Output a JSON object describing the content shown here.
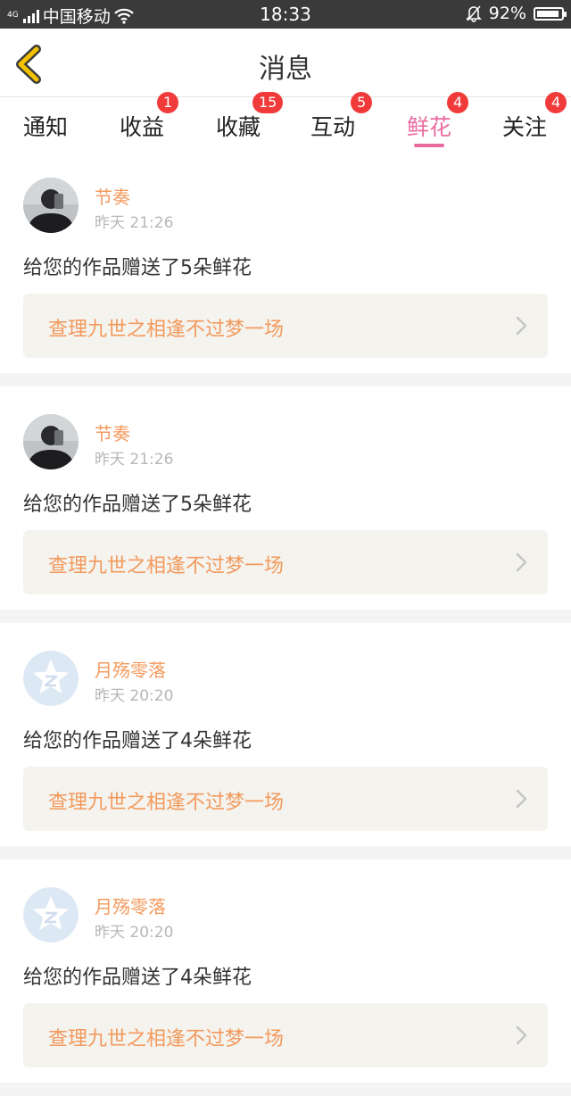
{
  "status_bar": {
    "signal_tag": "4G",
    "carrier": "中国移动",
    "time": "18:33",
    "battery": "92%",
    "battery_level": 0.92,
    "icons": [
      "signal-bars-icon",
      "wifi-icon",
      "bell-muted-icon",
      "battery-icon"
    ]
  },
  "header": {
    "title": "消息",
    "back_icon": "chevron-left-icon",
    "back_icon_color": "#f2c200"
  },
  "tabs": [
    {
      "label": "通知",
      "badge": ""
    },
    {
      "label": "收益",
      "badge": "1"
    },
    {
      "label": "收藏",
      "badge": "15"
    },
    {
      "label": "互动",
      "badge": "5"
    },
    {
      "label": "鲜花",
      "badge": "4",
      "active": true
    },
    {
      "label": "关注",
      "badge": "4"
    }
  ],
  "colors": {
    "accent_pink": "#ea6ba0",
    "username_orange": "#f39a5d",
    "badge_red": "#f13b3b"
  },
  "messages": [
    {
      "username": "节奏",
      "time": "昨天 21:26",
      "text": "给您的作品赠送了5朵鲜花",
      "work_title": "查理九世之相逢不过梦一场",
      "avatar": "photo-avatar"
    },
    {
      "username": "节奏",
      "time": "昨天 21:26",
      "text": "给您的作品赠送了5朵鲜花",
      "work_title": "查理九世之相逢不过梦一场",
      "avatar": "photo-avatar"
    },
    {
      "username": "月殇零落",
      "time": "昨天 20:20",
      "text": "给您的作品赠送了4朵鲜花",
      "work_title": "查理九世之相逢不过梦一场",
      "avatar": "default-star-avatar"
    },
    {
      "username": "月殇零落",
      "time": "昨天 20:20",
      "text": "给您的作品赠送了4朵鲜花",
      "work_title": "查理九世之相逢不过梦一场",
      "avatar": "default-star-avatar"
    }
  ]
}
